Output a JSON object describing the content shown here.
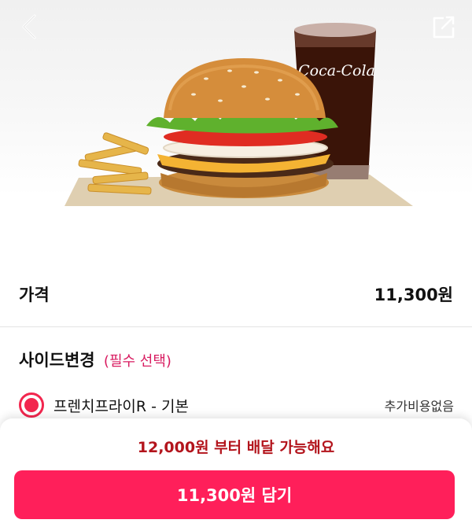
{
  "header": {
    "back_icon": "chevron-left-icon",
    "share_icon": "share-icon"
  },
  "hero": {
    "image": "burger-set-with-fries-and-cola",
    "cup_brand": "Coca-Cola"
  },
  "price": {
    "label": "가격",
    "value": "11,300원"
  },
  "side": {
    "title": "사이드변경",
    "required": "(필수 선택)",
    "options": [
      {
        "label": "프렌치프라이R - 기본",
        "extra": "추가비용없음",
        "selected": true
      }
    ]
  },
  "footer": {
    "min_order": "12,000원 부터 배달 가능해요",
    "add_button": "11,300원 담기"
  },
  "colors": {
    "accent": "#ff1f5a",
    "radio": "#f2264e",
    "required": "#d81b60",
    "min_order": "#b3141c"
  }
}
